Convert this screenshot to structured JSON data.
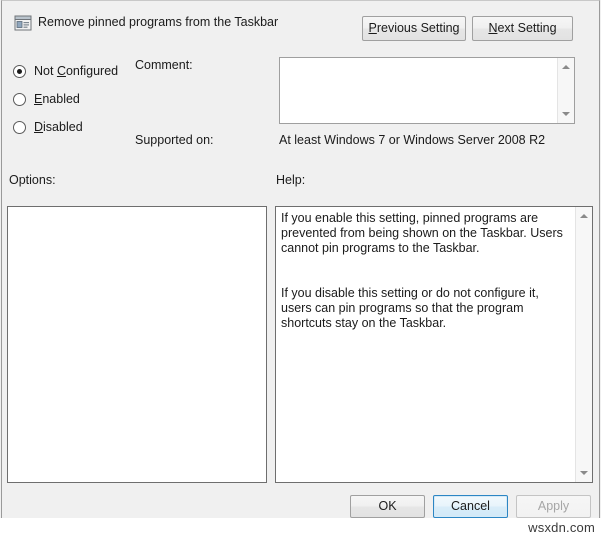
{
  "dialog": {
    "title": "Remove pinned programs from the Taskbar",
    "icon": "policy-setting-icon",
    "watermark": "wsxdn.com"
  },
  "navigation": {
    "previous_setting": {
      "label": "Previous Setting",
      "accel_prefix": "P",
      "accel_rest": "revious Setting"
    },
    "next_setting": {
      "label": "Next Setting",
      "accel_prefix": "N",
      "accel_rest": "ext Setting"
    }
  },
  "state_options": {
    "selected": "Not Configured",
    "items": [
      {
        "label": "Not Configured",
        "pre": "Not ",
        "accel": "C",
        "post": "onfigured",
        "checked": true
      },
      {
        "label": "Enabled",
        "pre": "",
        "accel": "E",
        "post": "nabled",
        "checked": false
      },
      {
        "label": "Disabled",
        "pre": "",
        "accel": "D",
        "post": "isabled",
        "checked": false
      }
    ]
  },
  "comment": {
    "label": "Comment:",
    "value": "",
    "placeholder": ""
  },
  "supported_on": {
    "label": "Supported on:",
    "value": "At least Windows 7 or Windows Server 2008 R2"
  },
  "options": {
    "label": "Options:",
    "value": ""
  },
  "help": {
    "label": "Help:",
    "text": "If you enable this setting, pinned programs are prevented from being shown on the Taskbar. Users cannot pin programs to the Taskbar.\n\n\nIf you disable this setting or do not configure it, users can pin programs so that the program shortcuts stay on the Taskbar."
  },
  "footer": {
    "ok_label": "OK",
    "cancel_label": "Cancel",
    "apply_label": "Apply",
    "apply_enabled": false,
    "focused": "Cancel"
  },
  "colors": {
    "dialog_background": "#f0f0f0",
    "field_background": "#ffffff",
    "text": "#1b1b1b",
    "focus_border": "#2c86c4",
    "disabled_text": "#a6a6a6",
    "panel_border": "#6e6e6e"
  }
}
